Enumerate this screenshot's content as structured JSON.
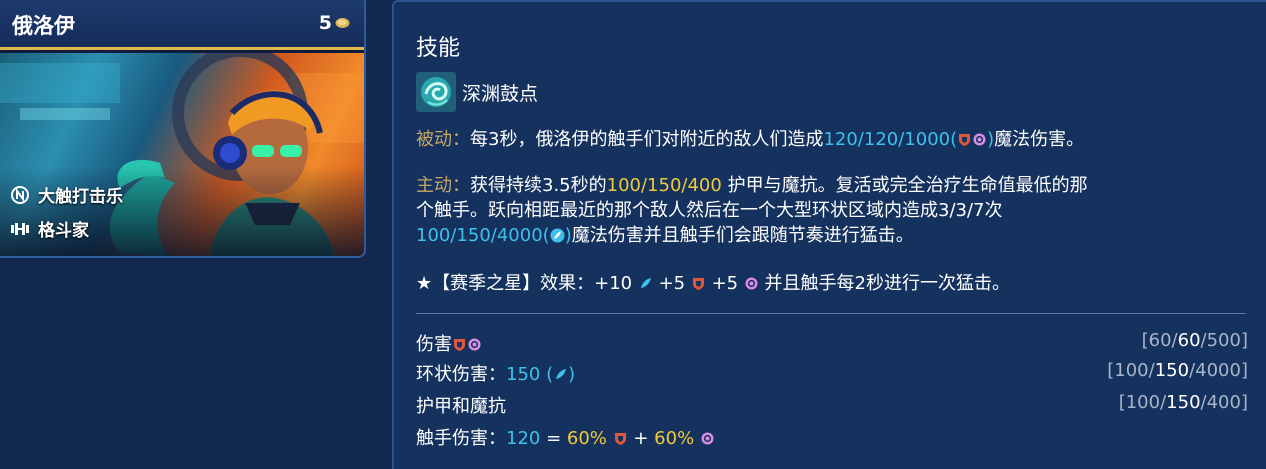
{
  "card": {
    "champion_name": "俄洛伊",
    "cost": "5",
    "traits": [
      {
        "label": "大触打击乐",
        "icon": "beat-drop-trait-icon"
      },
      {
        "label": "格斗家",
        "icon": "bruiser-trait-icon"
      }
    ]
  },
  "panel": {
    "title": "技能",
    "ability_name": "深渊鼓点",
    "passive": {
      "label": "被动：",
      "text_1": "每3秒，俄洛伊的触手们对附近的敌人们造成",
      "value": "120/120/1000(",
      "value_close": ")",
      "text_2": "魔法伤害。"
    },
    "active": {
      "label": "主动：",
      "line1_a": "获得持续3.5秒的",
      "line1_value": "100/150/400",
      "line1_b": " 护甲与魔抗。复活或完全治疗生命值最低的那",
      "line2": "个触手。跃向相距最近的那个敌人然后在一个大型环状区域内造成3/3/7次",
      "line3_value": "100/150/4000(",
      "line3_value_close": ")",
      "line3_b": "魔法伤害并且触手们会跟随节奏进行猛击。"
    },
    "star_line": {
      "prefix": "★【赛季之星】效果：+10 ",
      "mid1": " +5 ",
      "mid2": " +5 ",
      "suffix": " 并且触手每2秒进行一次猛击。"
    },
    "stats": [
      {
        "name": "伤害",
        "v1": "60",
        "v2": "60",
        "v3": "500"
      },
      {
        "name": "环状伤害：",
        "value": "150 (",
        "value_close": ")",
        "v1": "100",
        "v2": "150",
        "v3": "4000"
      },
      {
        "name": "护甲和魔抗",
        "v1": "100",
        "v2": "150",
        "v3": "400"
      },
      {
        "name": "触手伤害：",
        "value": "120",
        "eq": " = ",
        "pct1": "60%",
        "plus": " + ",
        "pct2": "60%"
      }
    ],
    "colors": {
      "label_gold": "#c6a765",
      "value_blue": "#3ec0ec",
      "value_gold": "#f0c838",
      "background": "#13284f"
    }
  }
}
